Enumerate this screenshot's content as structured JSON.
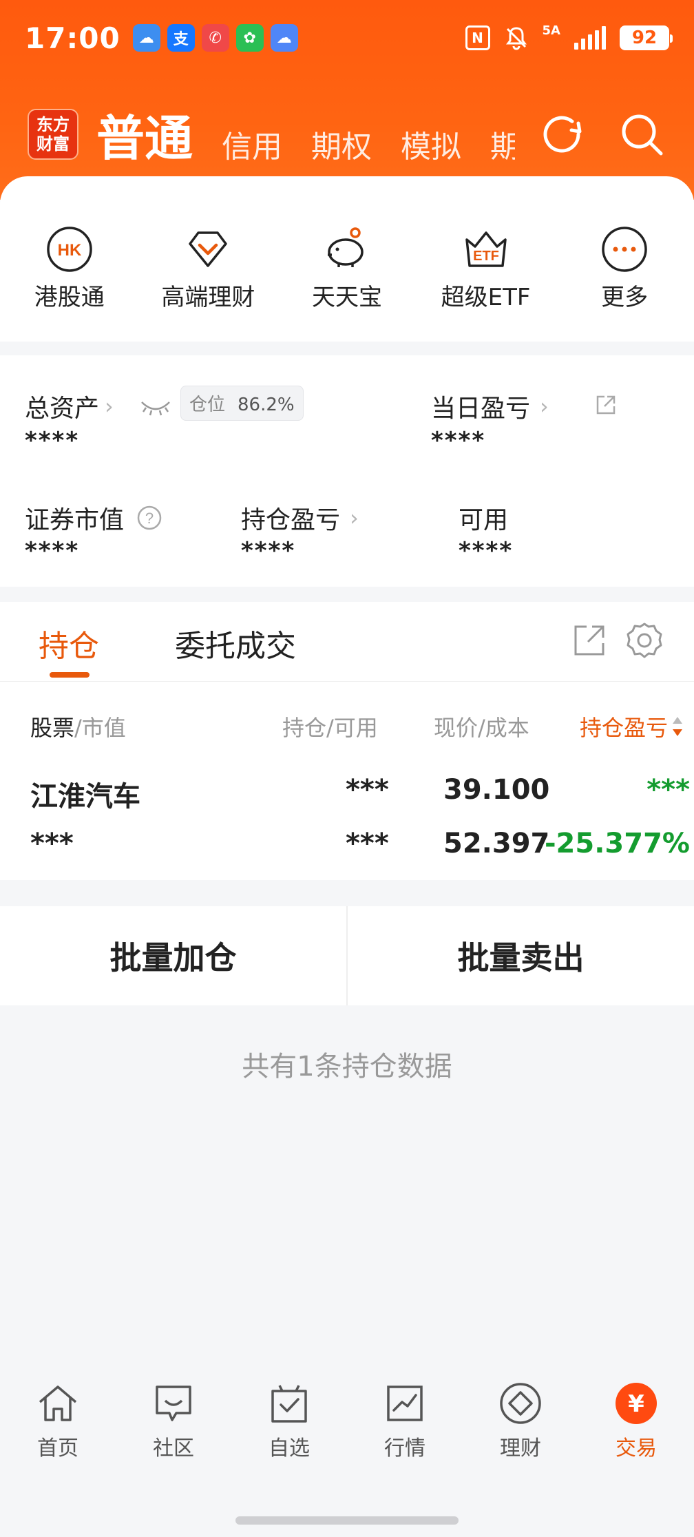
{
  "status_bar": {
    "time": "17:00",
    "network": "5A",
    "battery": "92",
    "apps": [
      "weather-app",
      "alipay-app",
      "phone-app",
      "wechat-app",
      "cloud-app"
    ]
  },
  "header": {
    "logo": "东方\n财富",
    "tabs": [
      {
        "label": "普通",
        "active": true
      },
      {
        "label": "信用"
      },
      {
        "label": "期权"
      },
      {
        "label": "模拟"
      },
      {
        "label": "期"
      }
    ]
  },
  "quick_links": [
    {
      "label": "港股通",
      "icon": "hk-icon",
      "icon_text": "HK"
    },
    {
      "label": "高端理财",
      "icon": "diamond-icon"
    },
    {
      "label": "天天宝",
      "icon": "piggy-bank-icon"
    },
    {
      "label": "超级ETF",
      "icon": "etf-crown-icon",
      "icon_text": "ETF"
    },
    {
      "label": "更多",
      "icon": "more-icon"
    }
  ],
  "assets": {
    "total_label": "总资产",
    "position_key": "仓位",
    "position_value": "86.2%",
    "total_value": "****",
    "daily_pl_label": "当日盈亏",
    "daily_pl_value": "****",
    "market_value_label": "证券市值",
    "market_value": "****",
    "holding_pl_label": "持仓盈亏",
    "holding_pl_value": "****",
    "available_label": "可用",
    "available_value": "****"
  },
  "holdings": {
    "tabs": [
      "持仓",
      "委托成交"
    ],
    "columns": {
      "col1a": "股票",
      "col1b": "/市值",
      "col2": "持仓/可用",
      "col3": "现价/成本",
      "col4": "持仓盈亏"
    },
    "rows": [
      {
        "name": "江淮汽车",
        "market_value": "***",
        "position": "***",
        "available": "***",
        "price": "39.100",
        "cost": "52.397",
        "pl": "***",
        "pl_pct": "-25.377%"
      }
    ]
  },
  "batch": {
    "add": "批量加仓",
    "sell": "批量卖出"
  },
  "summary": "共有1条持仓数据",
  "bottom_nav": [
    {
      "label": "首页",
      "icon": "home-icon"
    },
    {
      "label": "社区",
      "icon": "community-icon"
    },
    {
      "label": "自选",
      "icon": "watchlist-icon"
    },
    {
      "label": "行情",
      "icon": "market-chart-icon"
    },
    {
      "label": "理财",
      "icon": "wealth-icon"
    },
    {
      "label": "交易",
      "icon": "trade-yuan-icon",
      "active": true,
      "icon_text": "¥"
    }
  ],
  "colors": {
    "brand_orange": "#ff5a0e",
    "accent": "#e8590c",
    "gain_green": "#149c2f"
  }
}
